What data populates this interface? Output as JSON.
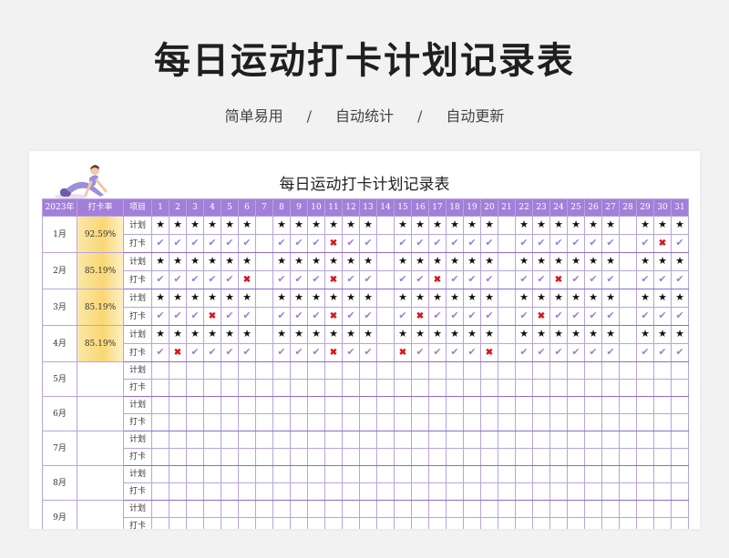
{
  "hero": {
    "title": "每日运动打卡计划记录表",
    "tags": [
      "简单易用",
      "自动统计",
      "自动更新"
    ],
    "separator": "/"
  },
  "sheet": {
    "title": "每日运动打卡计划记录表",
    "header": {
      "year": "2023年",
      "rate": "打卡率",
      "item": "项目",
      "days": [
        "1",
        "2",
        "3",
        "4",
        "5",
        "6",
        "7",
        "8",
        "9",
        "10",
        "11",
        "12",
        "13",
        "14",
        "15",
        "16",
        "17",
        "18",
        "19",
        "20",
        "21",
        "22",
        "23",
        "24",
        "25",
        "26",
        "27",
        "28",
        "29",
        "30",
        "31"
      ]
    },
    "row_labels": {
      "plan": "计划",
      "checkin": "打卡"
    },
    "symbols": {
      "plan": "★",
      "done": "✔",
      "miss": "✖"
    },
    "rest_days": [
      7,
      14,
      21,
      28
    ],
    "months": [
      {
        "name": "1月",
        "rate": "92.59%",
        "misses": [
          11,
          30
        ]
      },
      {
        "name": "2月",
        "rate": "85.19%",
        "misses": [
          6,
          11,
          17,
          24
        ]
      },
      {
        "name": "3月",
        "rate": "85.19%",
        "misses": [
          4,
          11,
          16,
          23
        ]
      },
      {
        "name": "4月",
        "rate": "85.19%",
        "misses": [
          2,
          11,
          15,
          20
        ]
      },
      {
        "name": "5月",
        "rate": "",
        "misses": []
      },
      {
        "name": "6月",
        "rate": "",
        "misses": []
      },
      {
        "name": "7月",
        "rate": "",
        "misses": []
      },
      {
        "name": "8月",
        "rate": "",
        "misses": []
      },
      {
        "name": "9月",
        "rate": "",
        "misses": []
      }
    ],
    "filled_months": 4,
    "colors": {
      "header_bg": "#a27fd8",
      "check": "#9b7fd4",
      "miss": "#d9141b",
      "rate_bg": "#f9d774"
    }
  }
}
